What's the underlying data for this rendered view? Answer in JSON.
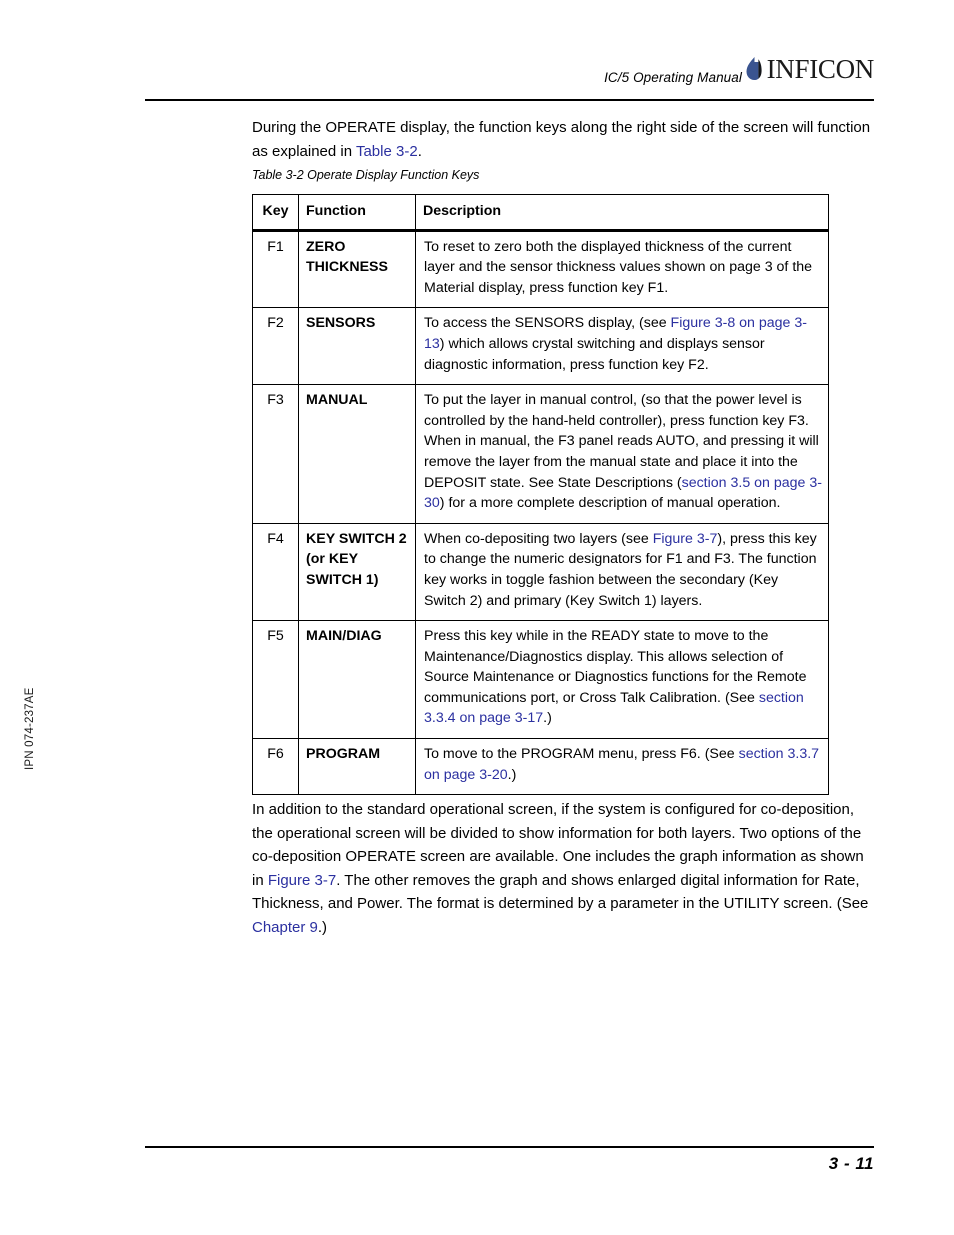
{
  "header": {
    "manual_title": "IC/5 Operating Manual",
    "logo_text": "INFICON",
    "logo_icon": "inficon-droplet-logo"
  },
  "intro_paragraph": {
    "part1": "During the OPERATE display, the function keys along the right side of the screen will function as explained in ",
    "link": "Table 3-2",
    "part2": "."
  },
  "table_caption": "Table 3-2  Operate Display Function Keys",
  "table": {
    "headers": [
      "Key",
      "Function",
      "Description"
    ],
    "rows": [
      {
        "key": "F1",
        "function": "ZERO THICKNESS",
        "description_html": "To reset to zero both the displayed thickness of the current layer and the sensor thickness values shown on page 3 of the Material display, press function key F1."
      },
      {
        "key": "F2",
        "function": "SENSORS",
        "description_html": "To access the SENSORS display, (see <span class=\"link\">Figure 3-8 on page 3-13</span>) which allows crystal switching and displays sensor diagnostic information, press function key F2."
      },
      {
        "key": "F3",
        "function": "MANUAL",
        "description_html": "To put the layer in manual control, (so that the power level is controlled by the hand-held controller), press function key F3. When in manual, the F3 panel reads AUTO, and pressing it will remove the layer from the manual state and place it into the DEPOSIT state. See State Descriptions (<span class=\"link\">section 3.5 on page 3-30</span>) for a more complete description of manual operation."
      },
      {
        "key": "F4",
        "function": "KEY SWITCH 2 (or KEY SWITCH 1)",
        "description_html": "When co-depositing two layers (see <span class=\"link\">Figure 3-7</span>), press this key to change the numeric designators for F1 and F3. The function key works in toggle fashion between the secondary (Key Switch 2) and primary (Key Switch 1) layers."
      },
      {
        "key": "F5",
        "function": "MAIN/DIAG",
        "description_html": "Press this key while in the READY state to move to the Maintenance/Diagnostics display. This allows selection of Source Maintenance or Diagnostics functions for the Remote communications port, or Cross Talk Calibration. (See <span class=\"link\">section 3.3.4 on page 3-17</span>.)"
      },
      {
        "key": "F6",
        "function": "PROGRAM",
        "description_html": "To move to the PROGRAM menu, press F6. (See <span class=\"link\">section 3.3.7 on page 3-20</span>.)"
      }
    ]
  },
  "closing_paragraph": {
    "part1": "In addition to the standard operational screen, if the system is configured for co-deposition, the operational screen will be divided to show information for both layers. Two options of the co-deposition OPERATE screen are available. One includes the graph information as shown in ",
    "link1": "Figure 3-7",
    "part2": ". The other removes the graph and shows enlarged digital information for Rate, Thickness, and Power. The format is determined by a parameter in the UTILITY screen. (See ",
    "link2": "Chapter 9",
    "part3": ".)"
  },
  "side_code": "IPN 074-237AE",
  "footer": {
    "page_number": "3 - 11"
  },
  "colors": {
    "link_blue": "#2b30a0",
    "logo_blue": "#3a5490",
    "text_black": "#000000"
  }
}
